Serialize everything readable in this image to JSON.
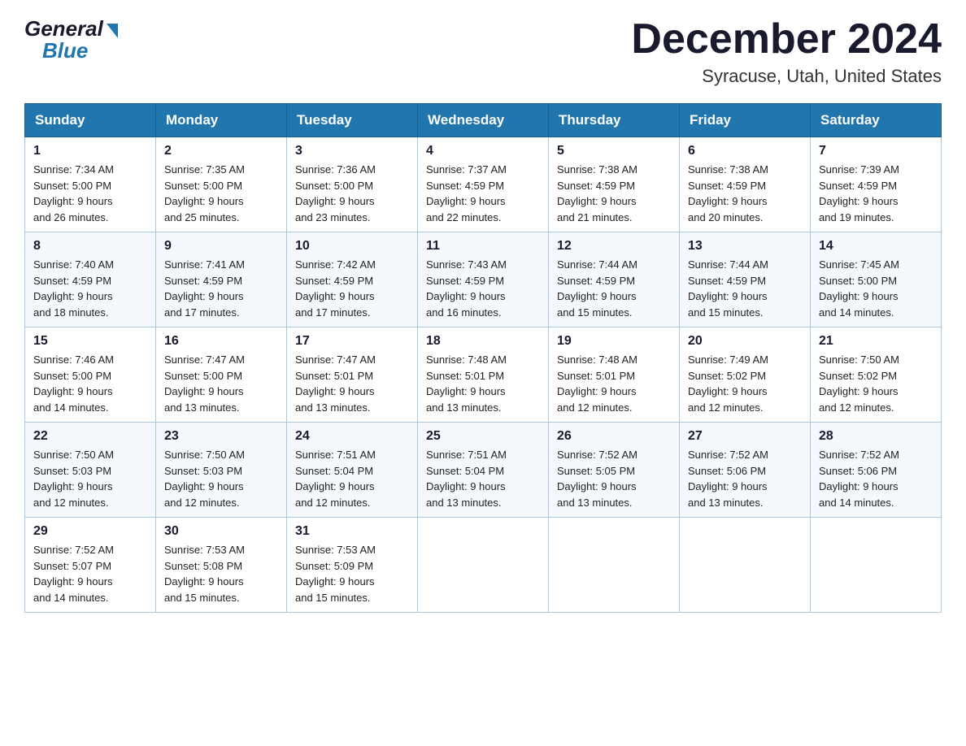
{
  "header": {
    "logo": {
      "general": "General",
      "blue": "Blue"
    },
    "title": "December 2024",
    "location": "Syracuse, Utah, United States"
  },
  "days_of_week": [
    "Sunday",
    "Monday",
    "Tuesday",
    "Wednesday",
    "Thursday",
    "Friday",
    "Saturday"
  ],
  "weeks": [
    [
      {
        "day": "1",
        "sunrise": "7:34 AM",
        "sunset": "5:00 PM",
        "daylight": "9 hours and 26 minutes."
      },
      {
        "day": "2",
        "sunrise": "7:35 AM",
        "sunset": "5:00 PM",
        "daylight": "9 hours and 25 minutes."
      },
      {
        "day": "3",
        "sunrise": "7:36 AM",
        "sunset": "5:00 PM",
        "daylight": "9 hours and 23 minutes."
      },
      {
        "day": "4",
        "sunrise": "7:37 AM",
        "sunset": "4:59 PM",
        "daylight": "9 hours and 22 minutes."
      },
      {
        "day": "5",
        "sunrise": "7:38 AM",
        "sunset": "4:59 PM",
        "daylight": "9 hours and 21 minutes."
      },
      {
        "day": "6",
        "sunrise": "7:38 AM",
        "sunset": "4:59 PM",
        "daylight": "9 hours and 20 minutes."
      },
      {
        "day": "7",
        "sunrise": "7:39 AM",
        "sunset": "4:59 PM",
        "daylight": "9 hours and 19 minutes."
      }
    ],
    [
      {
        "day": "8",
        "sunrise": "7:40 AM",
        "sunset": "4:59 PM",
        "daylight": "9 hours and 18 minutes."
      },
      {
        "day": "9",
        "sunrise": "7:41 AM",
        "sunset": "4:59 PM",
        "daylight": "9 hours and 17 minutes."
      },
      {
        "day": "10",
        "sunrise": "7:42 AM",
        "sunset": "4:59 PM",
        "daylight": "9 hours and 17 minutes."
      },
      {
        "day": "11",
        "sunrise": "7:43 AM",
        "sunset": "4:59 PM",
        "daylight": "9 hours and 16 minutes."
      },
      {
        "day": "12",
        "sunrise": "7:44 AM",
        "sunset": "4:59 PM",
        "daylight": "9 hours and 15 minutes."
      },
      {
        "day": "13",
        "sunrise": "7:44 AM",
        "sunset": "4:59 PM",
        "daylight": "9 hours and 15 minutes."
      },
      {
        "day": "14",
        "sunrise": "7:45 AM",
        "sunset": "5:00 PM",
        "daylight": "9 hours and 14 minutes."
      }
    ],
    [
      {
        "day": "15",
        "sunrise": "7:46 AM",
        "sunset": "5:00 PM",
        "daylight": "9 hours and 14 minutes."
      },
      {
        "day": "16",
        "sunrise": "7:47 AM",
        "sunset": "5:00 PM",
        "daylight": "9 hours and 13 minutes."
      },
      {
        "day": "17",
        "sunrise": "7:47 AM",
        "sunset": "5:01 PM",
        "daylight": "9 hours and 13 minutes."
      },
      {
        "day": "18",
        "sunrise": "7:48 AM",
        "sunset": "5:01 PM",
        "daylight": "9 hours and 13 minutes."
      },
      {
        "day": "19",
        "sunrise": "7:48 AM",
        "sunset": "5:01 PM",
        "daylight": "9 hours and 12 minutes."
      },
      {
        "day": "20",
        "sunrise": "7:49 AM",
        "sunset": "5:02 PM",
        "daylight": "9 hours and 12 minutes."
      },
      {
        "day": "21",
        "sunrise": "7:50 AM",
        "sunset": "5:02 PM",
        "daylight": "9 hours and 12 minutes."
      }
    ],
    [
      {
        "day": "22",
        "sunrise": "7:50 AM",
        "sunset": "5:03 PM",
        "daylight": "9 hours and 12 minutes."
      },
      {
        "day": "23",
        "sunrise": "7:50 AM",
        "sunset": "5:03 PM",
        "daylight": "9 hours and 12 minutes."
      },
      {
        "day": "24",
        "sunrise": "7:51 AM",
        "sunset": "5:04 PM",
        "daylight": "9 hours and 12 minutes."
      },
      {
        "day": "25",
        "sunrise": "7:51 AM",
        "sunset": "5:04 PM",
        "daylight": "9 hours and 13 minutes."
      },
      {
        "day": "26",
        "sunrise": "7:52 AM",
        "sunset": "5:05 PM",
        "daylight": "9 hours and 13 minutes."
      },
      {
        "day": "27",
        "sunrise": "7:52 AM",
        "sunset": "5:06 PM",
        "daylight": "9 hours and 13 minutes."
      },
      {
        "day": "28",
        "sunrise": "7:52 AM",
        "sunset": "5:06 PM",
        "daylight": "9 hours and 14 minutes."
      }
    ],
    [
      {
        "day": "29",
        "sunrise": "7:52 AM",
        "sunset": "5:07 PM",
        "daylight": "9 hours and 14 minutes."
      },
      {
        "day": "30",
        "sunrise": "7:53 AM",
        "sunset": "5:08 PM",
        "daylight": "9 hours and 15 minutes."
      },
      {
        "day": "31",
        "sunrise": "7:53 AM",
        "sunset": "5:09 PM",
        "daylight": "9 hours and 15 minutes."
      },
      null,
      null,
      null,
      null
    ]
  ],
  "labels": {
    "sunrise": "Sunrise:",
    "sunset": "Sunset:",
    "daylight": "Daylight:"
  }
}
